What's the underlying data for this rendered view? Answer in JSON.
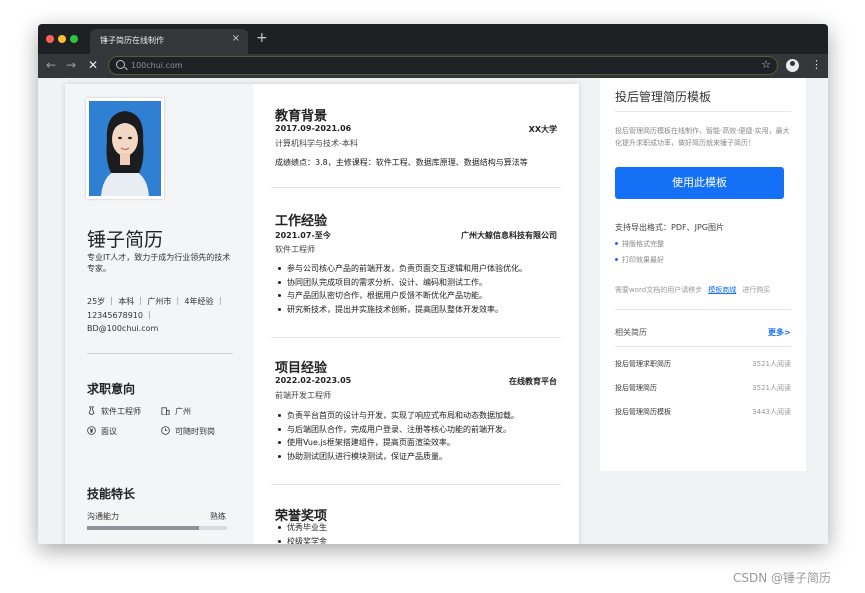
{
  "browser": {
    "tab_title": "锤子简历在线制作",
    "tab_close": "×",
    "new_tab": "+",
    "url": "100chui.com",
    "back": "←",
    "forward": "→",
    "stop": "✕",
    "star": "☆",
    "menu": "⋮",
    "traffic_colors": [
      "#ff5f57",
      "#febc2e",
      "#28c840"
    ]
  },
  "resume": {
    "name": "锤子简历",
    "intro": "专业IT人才，致力于成为行业领先的技术专家。",
    "info": [
      "25岁 ｜ 本科 ｜ 广州市 ｜ 4年经验 ｜",
      "12345678910 ｜",
      "BD@100chui.com"
    ],
    "intent_title": "求职意向",
    "intent": {
      "job": "软件工程师",
      "city": "广州",
      "salary": "面议",
      "availability": "可随时到岗"
    },
    "skills_title": "技能特长",
    "skill": {
      "name": "沟通能力",
      "level": "熟练",
      "fill": 0.8
    },
    "education": {
      "title": "教育背景",
      "period": "2017.09-2021.06",
      "school": "XX大学",
      "major": "计算机科学与技术-本科",
      "detail": "成绩绩点：3.8，主修课程：软件工程、数据库原理、数据结构与算法等"
    },
    "work": {
      "title": "工作经验",
      "period": "2021.07-至今",
      "company": "广州大鲸信息科技有限公司",
      "role": "软件工程师",
      "bullets": [
        "参与公司核心产品的前端开发，负责页面交互逻辑和用户体验优化。",
        "协同团队完成项目的需求分析、设计、编码和测试工作。",
        "与产品团队密切合作，根据用户反馈不断优化产品功能。",
        "研究新技术，提出并实施技术创新，提高团队整体开发效率。"
      ]
    },
    "project": {
      "title": "项目经验",
      "period": "2022.02-2023.05",
      "org": "在线教育平台",
      "role": "前端开发工程师",
      "bullets": [
        "负责平台首页的设计与开发，实现了响应式布局和动态数据加载。",
        "与后端团队合作，完成用户登录、注册等核心功能的前端开发。",
        "使用Vue.js框架搭建组件，提高页面渲染效率。",
        "协助测试团队进行模块测试，保证产品质量。"
      ]
    },
    "awards": {
      "title": "荣誉奖项",
      "items": [
        "优秀毕业生",
        "校级奖学金"
      ]
    }
  },
  "sidebar": {
    "title": "投后管理简历模板",
    "desc": "投后管理简历模板在线制作，智能·高效·便捷·实用，最大化提升求职成功率，做好简历就来锤子简历！",
    "use_button": "使用此模板",
    "formats": "支持导出格式：PDF、JPG图片",
    "bullets": [
      "排版格式完整",
      "打印效果最好"
    ],
    "need_text": "需要word文档的用户请移步",
    "need_link": "模板商城",
    "need_suffix": "进行购买",
    "related_title": "相关简历",
    "related_more": "更多>",
    "related": [
      {
        "title": "投后管理求职简历",
        "count": "3521人阅读"
      },
      {
        "title": "投后管理简历",
        "count": "3521人阅读"
      },
      {
        "title": "投后管理简历模板",
        "count": "3443人阅读"
      }
    ]
  },
  "watermark": "CSDN @锤子简历"
}
